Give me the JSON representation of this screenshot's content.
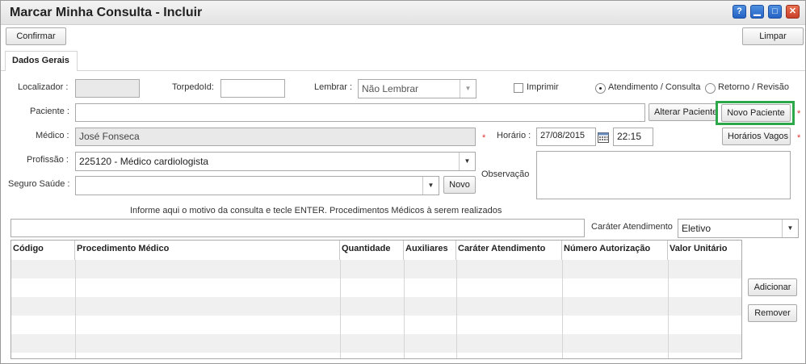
{
  "window": {
    "title": "Marcar Minha Consulta - Incluir",
    "buttons": {
      "help": "?",
      "minimize": "▁",
      "maximize": "□",
      "close": "✕"
    }
  },
  "toolbar": {
    "confirm_label": "Confirmar",
    "clear_label": "Limpar"
  },
  "tab": {
    "label": "Dados Gerais"
  },
  "form": {
    "localizador": {
      "label": "Localizador :",
      "value": ""
    },
    "torpedoid": {
      "label": "TorpedoId:",
      "value": ""
    },
    "lembrar": {
      "label": "Lembrar :",
      "value": "Não Lembrar"
    },
    "imprimir": {
      "label": "Imprimir",
      "checked": false
    },
    "tipo": {
      "option1": "Atendimento / Consulta",
      "option2": "Retorno / Revisão",
      "selected": "Atendimento / Consulta"
    },
    "paciente": {
      "label": "Paciente :",
      "value": ""
    },
    "alterar_paciente": "Alterar Paciente",
    "novo_paciente": "Novo Paciente",
    "medico": {
      "label": "Médico :",
      "value": "José Fonseca"
    },
    "horario": {
      "label": "Horário :",
      "date": "27/08/2015",
      "time": "22:15"
    },
    "horarios_vagos": "Horários Vagos",
    "profissao": {
      "label": "Profissão :",
      "value": "225120 - Médico cardiologista"
    },
    "observacao": {
      "label": "Observação",
      "value": ""
    },
    "seguro": {
      "label": "Seguro Saúde :",
      "value": ""
    },
    "novo": "Novo",
    "required_mark": "*",
    "motivo_hint": "Informe aqui o motivo da consulta e tecle ENTER. Procedimentos Médicos à serem realizados",
    "motivo_value": "",
    "carater": {
      "label": "Caráter Atendimento",
      "value": "Eletivo"
    }
  },
  "grid": {
    "columns": [
      "Código",
      "Procedimento Médico",
      "Quantidade",
      "Auxiliares",
      "Caráter Atendimento",
      "Número Autorização",
      "Valor Unitário"
    ],
    "rows": []
  },
  "actions": {
    "add_label": "Adicionar",
    "remove_label": "Remover"
  },
  "colors": {
    "highlight": "#2ca84a",
    "required": "#e03030"
  },
  "icons": {
    "calendar": "calendar-icon",
    "dropdown": "chevron-down-icon"
  }
}
